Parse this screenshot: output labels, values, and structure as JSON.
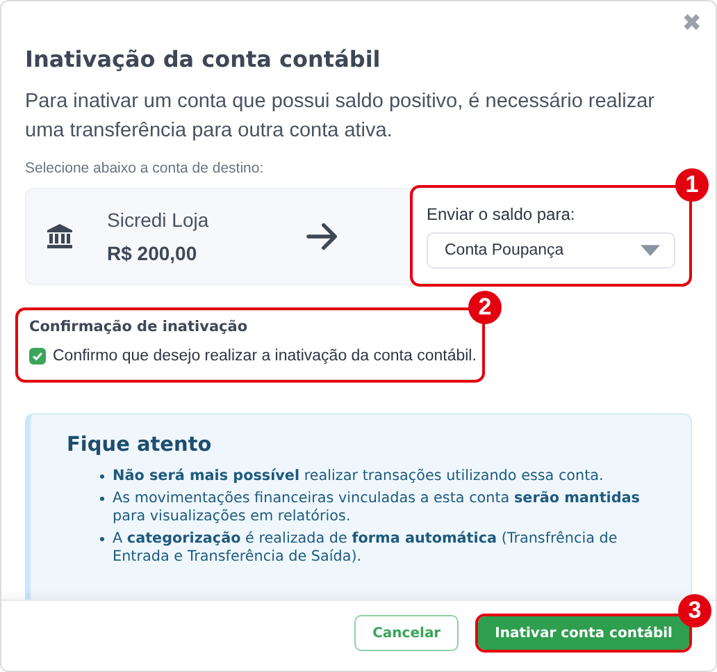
{
  "dialog": {
    "title": "Inativação da conta contábil",
    "close_icon": "✖",
    "description": "Para inativar um conta que possui saldo positivo, é necessário realizar uma transferência para outra conta ativa."
  },
  "destination": {
    "label": "Selecione abaixo a conta de destino:",
    "source_account": {
      "name": "Sicredi Loja",
      "balance": "R$ 200,00"
    },
    "target": {
      "label": "Enviar o saldo para:",
      "value": "Conta Poupança",
      "annotation": "1"
    }
  },
  "confirmation": {
    "title": "Confirmação de inativação",
    "checkbox_label": "Confirmo que desejo realizar a inativação da conta contábil.",
    "checked": true,
    "annotation": "2"
  },
  "notice": {
    "title": "Fique atento",
    "items": [
      "**Não será mais possível** realizar transações utilizando essa conta.",
      "As movimentações financeiras vinculadas a esta conta **serão mantidas** para visualizações em relatórios.",
      "A **categorização** é realizada de **forma automática** (Transfrência de Entrada e Transferência de Saída)."
    ]
  },
  "footer": {
    "cancel": "Cancelar",
    "confirm": "Inativar conta contábil",
    "confirm_annotation": "3"
  }
}
